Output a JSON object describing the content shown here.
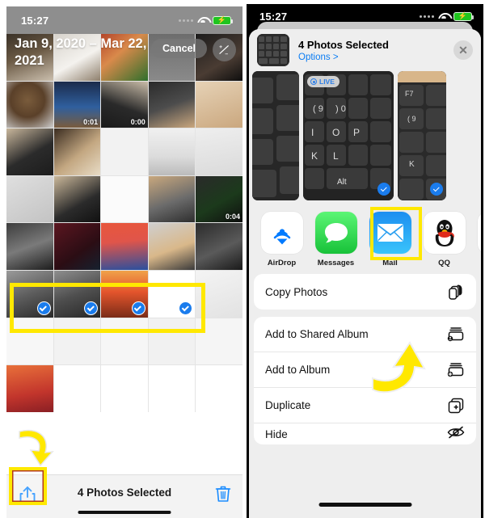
{
  "left": {
    "status": {
      "time": "15:27",
      "wifi": "wifi-icon",
      "battery": "battery-charging-icon"
    },
    "header": {
      "date_range": "Jan 9, 2020 – Mar 22, 2021",
      "cancel_label": "Cancel",
      "zoom_label": "+/-"
    },
    "grid": {
      "video_durations": [
        "0:01",
        "0:00",
        "0:04"
      ],
      "selected_count": 4
    },
    "toolbar": {
      "share_icon": "share-icon",
      "status_label": "4 Photos Selected",
      "trash_icon": "trash-icon"
    },
    "highlight_color": "#ffe800"
  },
  "right": {
    "status": {
      "time": "15:27",
      "wifi": "wifi-icon",
      "battery": "battery-charging-icon"
    },
    "sheet": {
      "title": "4 Photos Selected",
      "options_label": "Options >",
      "close_icon": "close-icon",
      "live_badge": "LIVE"
    },
    "apps": [
      {
        "name": "AirDrop",
        "icon": "airdrop-icon"
      },
      {
        "name": "Messages",
        "icon": "messages-icon"
      },
      {
        "name": "Mail",
        "icon": "mail-icon"
      },
      {
        "name": "QQ",
        "icon": "qq-icon"
      }
    ],
    "actions": [
      {
        "group": 1,
        "label": "Copy Photos",
        "icon": "copy-icon"
      },
      {
        "group": 2,
        "label": "Add to Shared Album",
        "icon": "shared-album-icon"
      },
      {
        "group": 2,
        "label": "Add to Album",
        "icon": "add-album-icon"
      },
      {
        "group": 2,
        "label": "Duplicate",
        "icon": "duplicate-icon"
      },
      {
        "group": 2,
        "label": "Hide",
        "icon": "hide-icon"
      }
    ],
    "accent_blue": "#0a7cf3",
    "highlight_color": "#ffe800"
  }
}
